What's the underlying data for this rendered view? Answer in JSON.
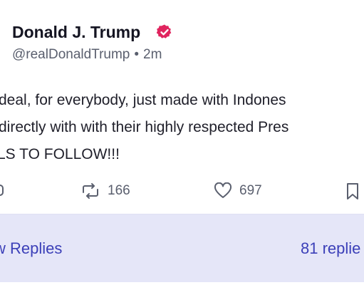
{
  "author": {
    "display_name": "Donald J. Trump",
    "handle": "@realDonaldTrump",
    "separator": "•",
    "time_ago": "2m",
    "verified_icon": "verified-badge-icon",
    "verified_color": "#e0245e"
  },
  "post": {
    "lines": [
      "deal, for everybody, just made with Indones",
      "directly with with their highly respected Pres",
      "LS TO FOLLOW!!!"
    ]
  },
  "actions": {
    "reply_icon": "reply-icon",
    "repost_icon": "repost-icon",
    "repost_count": "166",
    "like_icon": "heart-icon",
    "like_count": "697",
    "bookmark_icon": "bookmark-icon"
  },
  "replies": {
    "view_label": "w Replies",
    "count_label": "81 replie"
  },
  "colors": {
    "accent": "#3b3fb8",
    "replies_background": "#e5e6f8",
    "muted_text": "#5a5f6e"
  }
}
